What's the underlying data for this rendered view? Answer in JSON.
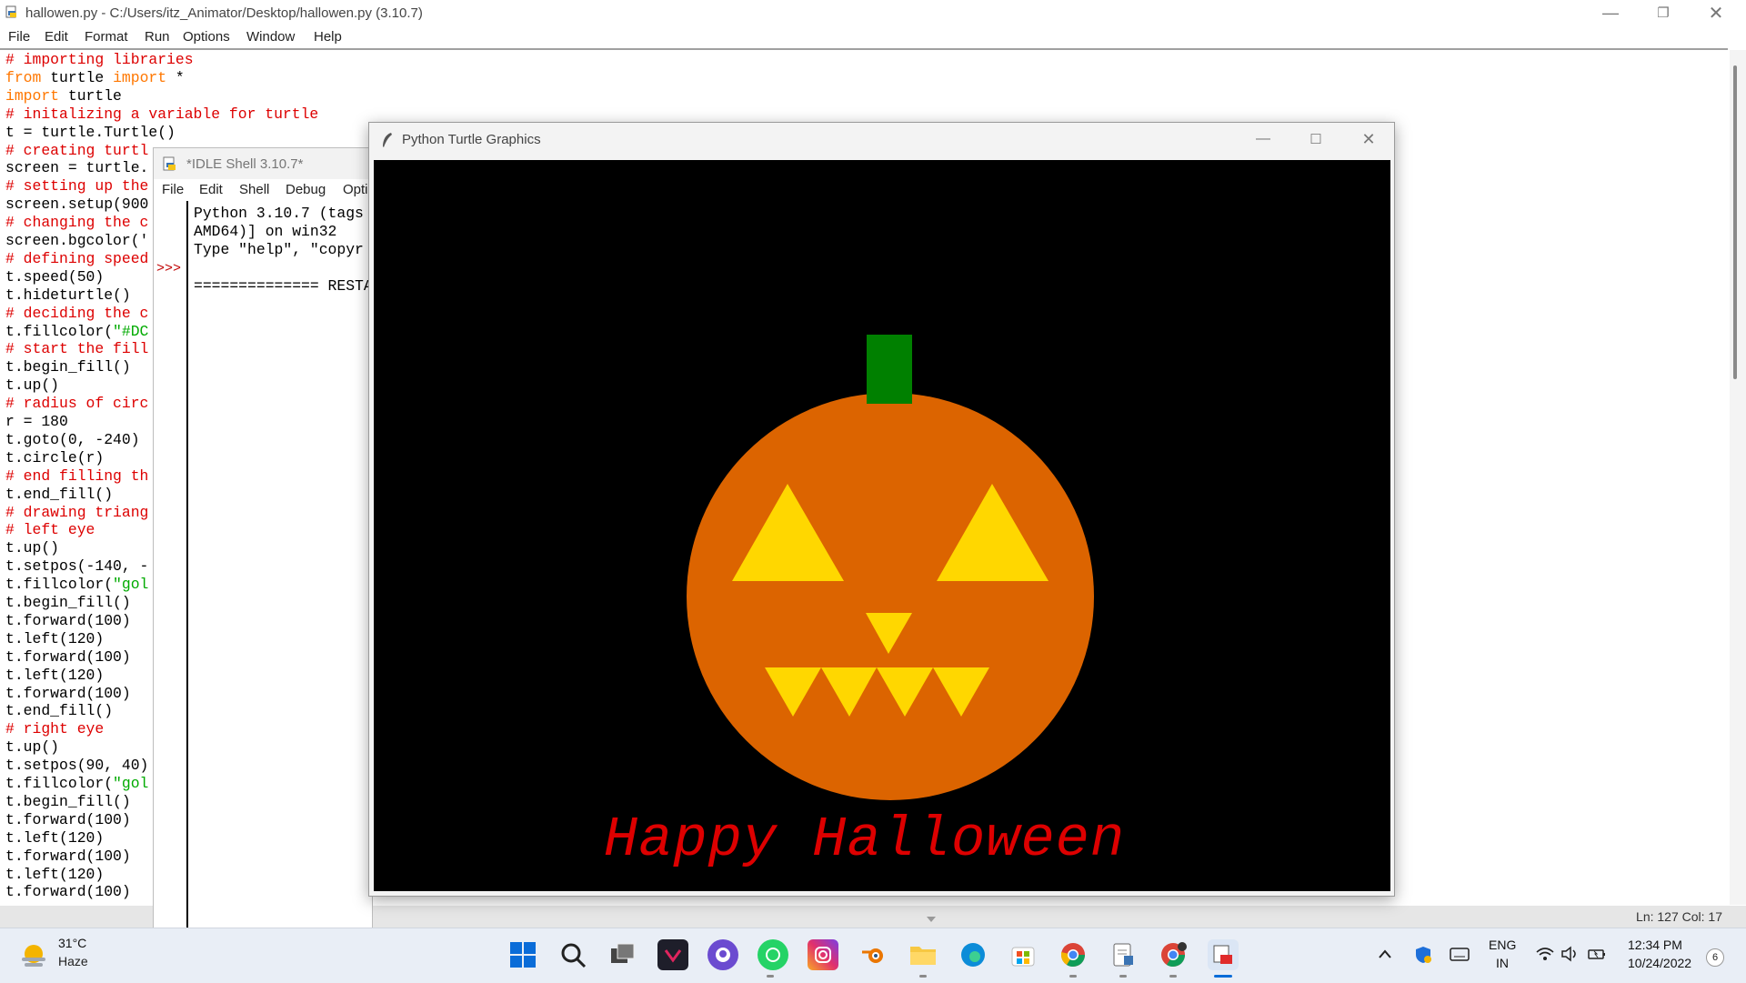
{
  "editor": {
    "title": "hallowen.py - C:/Users/itz_Animator/Desktop/hallowen.py (3.10.7)",
    "menu": [
      "File",
      "Edit",
      "Format",
      "Run",
      "Options",
      "Window",
      "Help"
    ],
    "status": "Ln: 127   Col: 17",
    "code_lines": [
      {
        "parts": [
          {
            "t": "# importing libraries",
            "c": "cm"
          }
        ]
      },
      {
        "parts": [
          {
            "t": "from",
            "c": "kw"
          },
          {
            "t": " turtle ",
            "c": "pl"
          },
          {
            "t": "import",
            "c": "kw"
          },
          {
            "t": " *",
            "c": "pl"
          }
        ]
      },
      {
        "parts": [
          {
            "t": "import",
            "c": "kw"
          },
          {
            "t": " turtle",
            "c": "pl"
          }
        ]
      },
      {
        "parts": [
          {
            "t": "# initalizing a variable for turtle",
            "c": "cm"
          }
        ]
      },
      {
        "parts": [
          {
            "t": "t = turtle.Turtle()",
            "c": "pl"
          }
        ]
      },
      {
        "parts": [
          {
            "t": "# creating turtl",
            "c": "cm"
          }
        ]
      },
      {
        "parts": [
          {
            "t": "screen = turtle.",
            "c": "pl"
          }
        ]
      },
      {
        "parts": [
          {
            "t": "# setting up the",
            "c": "cm"
          }
        ]
      },
      {
        "parts": [
          {
            "t": "screen.setup(900",
            "c": "pl"
          }
        ]
      },
      {
        "parts": [
          {
            "t": "# changing the c",
            "c": "cm"
          }
        ]
      },
      {
        "parts": [
          {
            "t": "screen.bgcolor('",
            "c": "pl"
          }
        ]
      },
      {
        "parts": [
          {
            "t": "# defining speed",
            "c": "cm"
          }
        ]
      },
      {
        "parts": [
          {
            "t": "t.speed(50)",
            "c": "pl"
          }
        ]
      },
      {
        "parts": [
          {
            "t": "t.hideturtle()",
            "c": "pl"
          }
        ]
      },
      {
        "parts": [
          {
            "t": "# deciding the c",
            "c": "cm"
          }
        ]
      },
      {
        "parts": [
          {
            "t": "t.fillcolor(",
            "c": "pl"
          },
          {
            "t": "\"#DC",
            "c": "st"
          }
        ]
      },
      {
        "parts": [
          {
            "t": "# start the fill",
            "c": "cm"
          }
        ]
      },
      {
        "parts": [
          {
            "t": "t.begin_fill()",
            "c": "pl"
          }
        ]
      },
      {
        "parts": [
          {
            "t": "t.up()",
            "c": "pl"
          }
        ]
      },
      {
        "parts": [
          {
            "t": "# radius of circ",
            "c": "cm"
          }
        ]
      },
      {
        "parts": [
          {
            "t": "r = 180",
            "c": "pl"
          }
        ]
      },
      {
        "parts": [
          {
            "t": "t.goto(0, -240)",
            "c": "pl"
          }
        ]
      },
      {
        "parts": [
          {
            "t": "t.circle(r)",
            "c": "pl"
          }
        ]
      },
      {
        "parts": [
          {
            "t": "# end filling th",
            "c": "cm"
          }
        ]
      },
      {
        "parts": [
          {
            "t": "t.end_fill()",
            "c": "pl"
          }
        ]
      },
      {
        "parts": [
          {
            "t": "# drawing triang",
            "c": "cm"
          }
        ]
      },
      {
        "parts": [
          {
            "t": "# left eye",
            "c": "cm"
          }
        ]
      },
      {
        "parts": [
          {
            "t": "t.up()",
            "c": "pl"
          }
        ]
      },
      {
        "parts": [
          {
            "t": "t.setpos(-140, -",
            "c": "pl"
          }
        ]
      },
      {
        "parts": [
          {
            "t": "t.fillcolor(",
            "c": "pl"
          },
          {
            "t": "\"gol",
            "c": "st"
          }
        ]
      },
      {
        "parts": [
          {
            "t": "t.begin_fill()",
            "c": "pl"
          }
        ]
      },
      {
        "parts": [
          {
            "t": "t.forward(100)",
            "c": "pl"
          }
        ]
      },
      {
        "parts": [
          {
            "t": "t.left(120)",
            "c": "pl"
          }
        ]
      },
      {
        "parts": [
          {
            "t": "t.forward(100)",
            "c": "pl"
          }
        ]
      },
      {
        "parts": [
          {
            "t": "t.left(120)",
            "c": "pl"
          }
        ]
      },
      {
        "parts": [
          {
            "t": "t.forward(100)",
            "c": "pl"
          }
        ]
      },
      {
        "parts": [
          {
            "t": "t.end_fill()",
            "c": "pl"
          }
        ]
      },
      {
        "parts": [
          {
            "t": "# right eye",
            "c": "cm"
          }
        ]
      },
      {
        "parts": [
          {
            "t": "t.up()",
            "c": "pl"
          }
        ]
      },
      {
        "parts": [
          {
            "t": "t.setpos(90, 40)",
            "c": "pl"
          }
        ]
      },
      {
        "parts": [
          {
            "t": "t.fillcolor(",
            "c": "pl"
          },
          {
            "t": "\"gol",
            "c": "st"
          }
        ]
      },
      {
        "parts": [
          {
            "t": "t.begin_fill()",
            "c": "pl"
          }
        ]
      },
      {
        "parts": [
          {
            "t": "t.forward(100)",
            "c": "pl"
          }
        ]
      },
      {
        "parts": [
          {
            "t": "t.left(120)",
            "c": "pl"
          }
        ]
      },
      {
        "parts": [
          {
            "t": "t.forward(100)",
            "c": "pl"
          }
        ]
      },
      {
        "parts": [
          {
            "t": "t.left(120)",
            "c": "pl"
          }
        ]
      },
      {
        "parts": [
          {
            "t": "t.forward(100)",
            "c": "pl"
          }
        ]
      }
    ]
  },
  "shell": {
    "title": "*IDLE Shell 3.10.7*",
    "menu": [
      "File",
      "Edit",
      "Shell",
      "Debug",
      "Opti"
    ],
    "prompt": ">>>",
    "text": "Python 3.10.7 (tags\nAMD64)] on win32\nType \"help\", \"copyr\n\n============== RESTA"
  },
  "turtle_window": {
    "title": "Python Turtle Graphics",
    "greeting": "Happy Halloween",
    "colors": {
      "background": "#000000",
      "pumpkin": "#dc6400",
      "stem": "#008000",
      "face": "#ffd700",
      "text": "#dd0000"
    }
  },
  "taskbar": {
    "weather_temp": "31°C",
    "weather_desc": "Haze",
    "lang_top": "ENG",
    "lang_bottom": "IN",
    "time": "12:34 PM",
    "date": "10/24/2022",
    "notification_count": "6",
    "apps": [
      "start-icon",
      "search-icon",
      "task-view-icon",
      "vscode-like-icon",
      "github-icon",
      "whatsapp-icon",
      "instagram-icon",
      "blender-icon",
      "file-explorer-icon",
      "edge-icon",
      "store-icon",
      "chrome-icon",
      "notepad-icon",
      "chrome-profile-icon",
      "idle-icon"
    ]
  }
}
